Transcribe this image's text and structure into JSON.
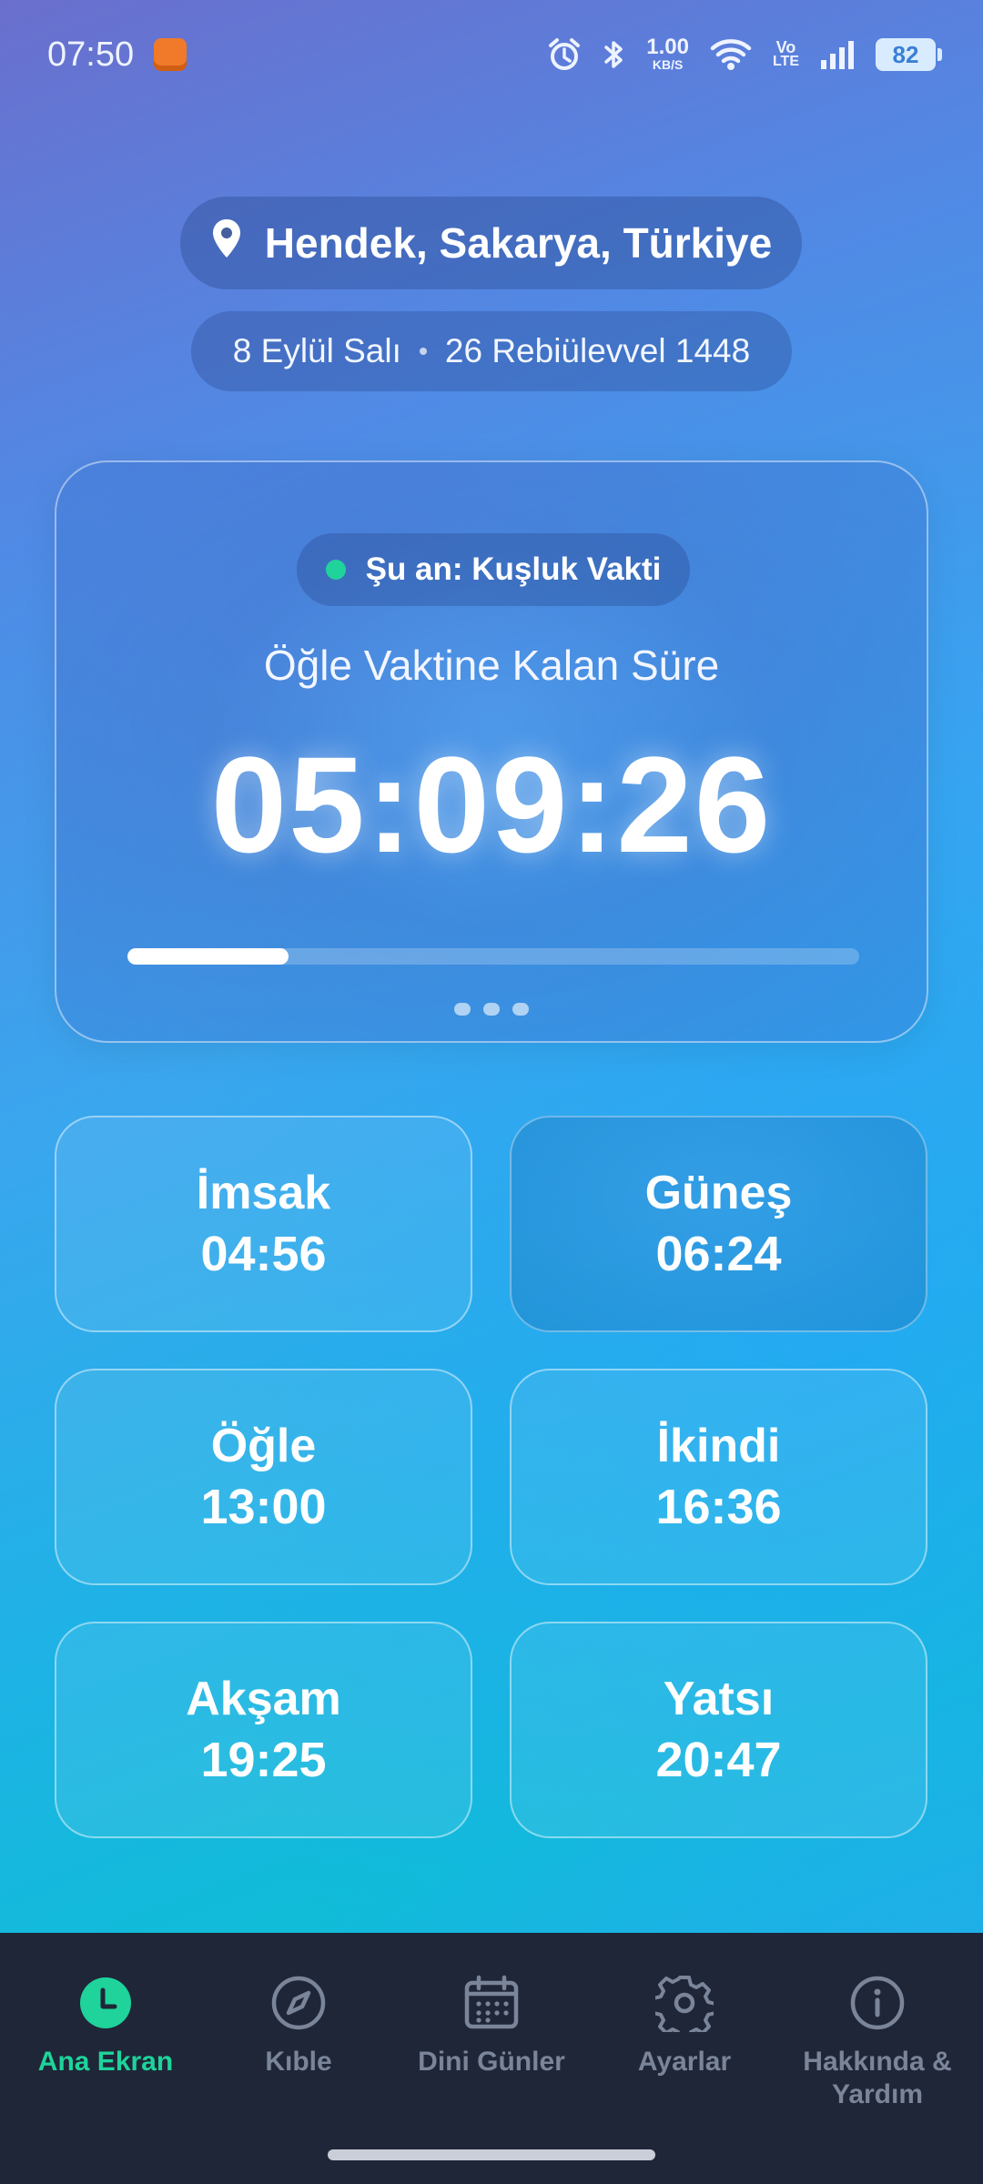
{
  "status_bar": {
    "time": "07:50",
    "net_speed_value": "1.00",
    "net_speed_unit": "KB/S",
    "volte_top": "Vo",
    "volte_bottom": "LTE",
    "battery": "82"
  },
  "header": {
    "location": "Hendek, Sakarya, Türkiye",
    "date_gregorian": "8 Eylül Salı",
    "date_hijri": "26 Rebiülevvel 1448"
  },
  "countdown_card": {
    "current_label": "Şu an: Kuşluk Vakti",
    "title": "Öğle Vaktine Kalan Süre",
    "remaining": "05:09:26",
    "progress_fraction": 0.22,
    "page_count": 3
  },
  "prayers": [
    {
      "name": "İmsak",
      "time": "04:56",
      "active": false
    },
    {
      "name": "Güneş",
      "time": "06:24",
      "active": true
    },
    {
      "name": "Öğle",
      "time": "13:00",
      "active": false
    },
    {
      "name": "İkindi",
      "time": "16:36",
      "active": false
    },
    {
      "name": "Akşam",
      "time": "19:25",
      "active": false
    },
    {
      "name": "Yatsı",
      "time": "20:47",
      "active": false
    }
  ],
  "nav": [
    {
      "label": "Ana Ekran",
      "icon": "clock-icon",
      "active": true
    },
    {
      "label": "Kıble",
      "icon": "compass-icon",
      "active": false
    },
    {
      "label": "Dini Günler",
      "icon": "calendar-icon",
      "active": false
    },
    {
      "label": "Ayarlar",
      "icon": "gear-icon",
      "active": false
    },
    {
      "label": "Hakkında & Yardım",
      "icon": "info-icon",
      "active": false
    }
  ],
  "colors": {
    "accent": "#1fd39a",
    "nav_bg": "#1f2638",
    "nav_inactive": "#7b8599"
  }
}
